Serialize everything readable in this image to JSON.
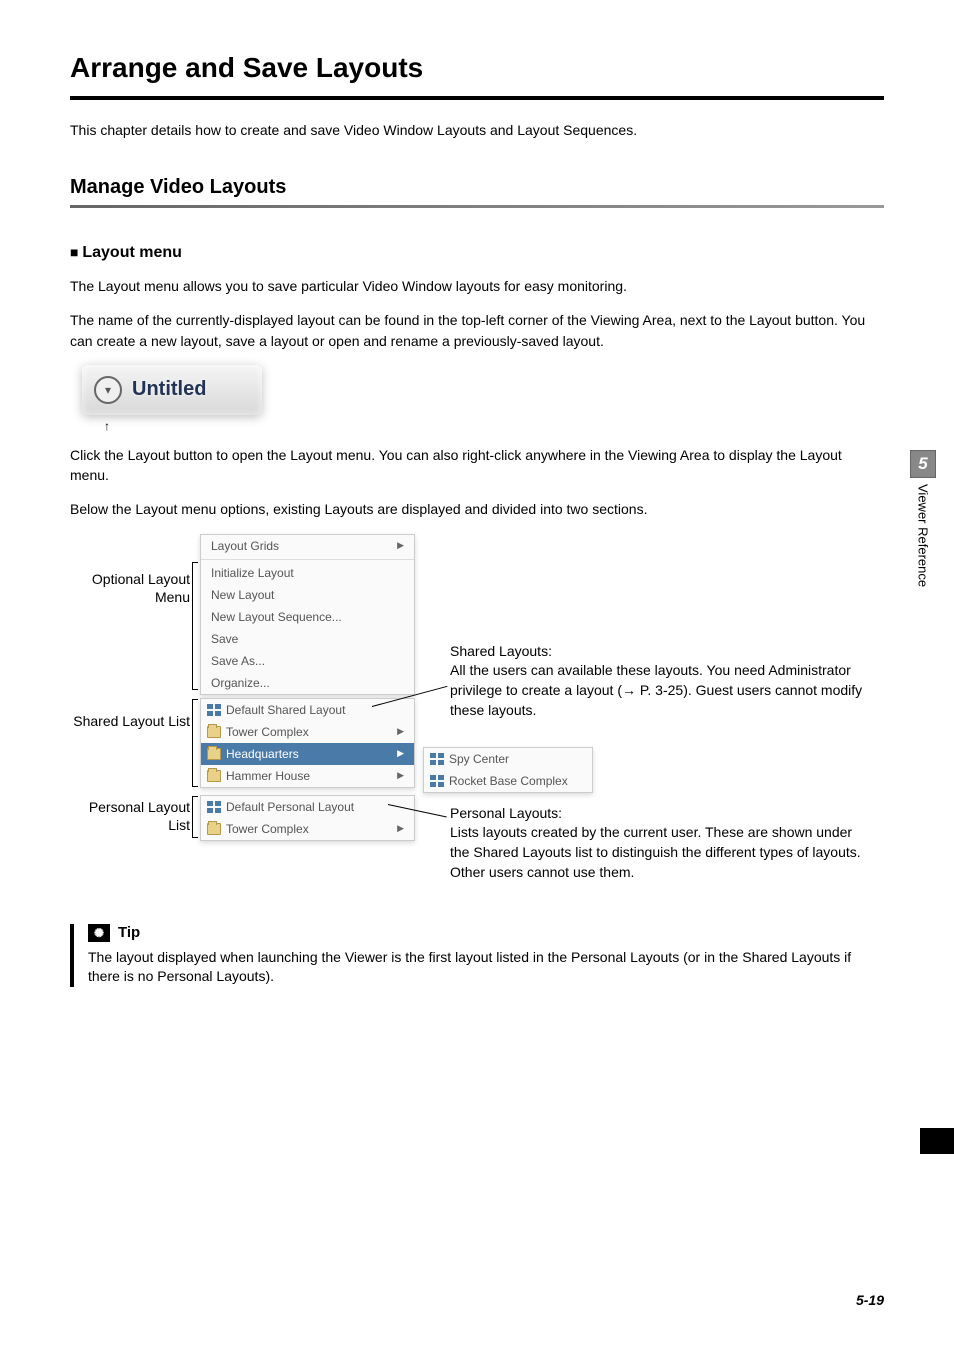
{
  "title": "Arrange and Save Layouts",
  "intro": "This chapter details how to create and save Video Window Layouts and Layout Sequences.",
  "section1": "Manage Video Layouts",
  "sub1": "Layout menu",
  "p1": "The Layout menu allows you to save particular Video Window layouts for easy monitoring.",
  "p2": "The name of the currently-displayed layout can be found in the top-left corner of the Viewing Area, next to the Layout button. You can create a new layout, save a layout or open and rename a previously-saved layout.",
  "layoutBtn": "Untitled",
  "p3": "Click the Layout button to open the Layout menu. You can also right-click anywhere in the Viewing Area to display the Layout menu.",
  "p4": "Below the Layout menu options, existing Layouts are displayed and divided into two sections.",
  "labels": {
    "optional": "Optional Layout Menu",
    "shared": "Shared Layout List",
    "personal": "Personal Layout List"
  },
  "menu": {
    "layoutGrids": "Layout Grids",
    "initialize": "Initialize Layout",
    "newLayout": "New Layout",
    "newSeq": "New Layout Sequence...",
    "save": "Save",
    "saveAs": "Save As...",
    "organize": "Organize...",
    "defaultShared": "Default Shared Layout",
    "towerComplex": "Tower Complex",
    "headquarters": "Headquarters",
    "hammerHouse": "Hammer House",
    "defaultPersonal": "Default Personal Layout",
    "towerComplex2": "Tower Complex"
  },
  "submenu": {
    "spyCenter": "Spy Center",
    "rocketBase": "Rocket Base Complex"
  },
  "callouts": {
    "sharedTitle": "Shared Layouts:",
    "sharedBody": "All the users can available these layouts. You need Administrator privilege to create a layout (→ P. 3-25). Guest users cannot modify these layouts.",
    "personalTitle": "Personal Layouts:",
    "personalBody": "Lists layouts created by the current user. These are shown under the Shared Layouts list to distinguish the different types of layouts. Other users cannot use them."
  },
  "tip": {
    "label": "Tip",
    "body": "The layout displayed when launching the Viewer is the first layout listed in the Personal Layouts (or in the Shared Layouts if there is no Personal Layouts)."
  },
  "sideTab": {
    "num": "5",
    "label": "Viewer Reference"
  },
  "pageNum": "5-19"
}
